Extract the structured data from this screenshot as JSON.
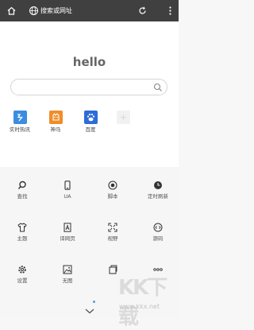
{
  "toolbar": {
    "address_placeholder": "搜索或网址"
  },
  "home": {
    "logo_text": "hello",
    "search_placeholder": ""
  },
  "quick_sites": [
    {
      "label": "实时热讯",
      "color": "#3a8de0"
    },
    {
      "label": "神马",
      "color": "#f08d2a"
    },
    {
      "label": "百度",
      "color": "#2d6bd9"
    }
  ],
  "menu": {
    "row1": [
      {
        "label": "查找",
        "icon": "search-icon"
      },
      {
        "label": "UA",
        "icon": "phone-icon"
      },
      {
        "label": "脚本",
        "icon": "script-icon"
      },
      {
        "label": "定时刷新",
        "icon": "clock-icon"
      }
    ],
    "row2": [
      {
        "label": "主题",
        "icon": "shirt-icon"
      },
      {
        "label": "译网页",
        "icon": "translate-icon"
      },
      {
        "label": "视野",
        "icon": "fullscreen-icon"
      },
      {
        "label": "源码",
        "icon": "code-icon"
      }
    ],
    "row3": [
      {
        "label": "设置",
        "icon": "gear-icon"
      },
      {
        "label": "无图",
        "icon": "image-icon"
      },
      {
        "label": "",
        "icon": "window-icon"
      },
      {
        "label": "",
        "icon": "more-icon"
      }
    ]
  },
  "watermark": {
    "text": "KK下载",
    "url": "www.kkx.net"
  }
}
